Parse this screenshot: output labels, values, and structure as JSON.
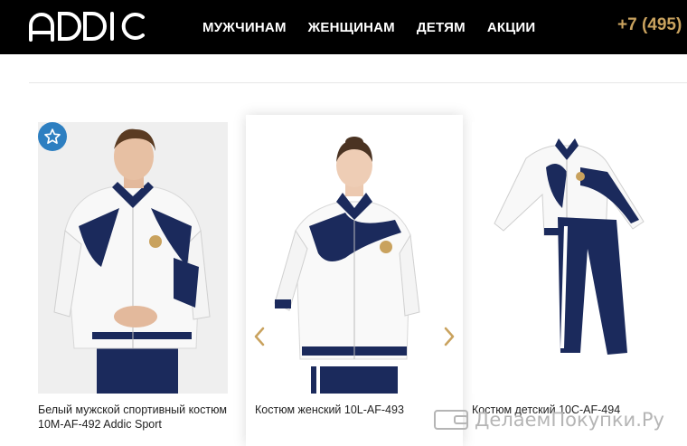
{
  "header": {
    "logo_text": "ADDIC",
    "nav": [
      "МУЖЧИНАМ",
      "ЖЕНЩИНАМ",
      "ДЕТЯМ",
      "АКЦИИ"
    ],
    "phone": "+7 (495)"
  },
  "products": [
    {
      "title": "Белый мужской спортивный костюм 10M-AF-492 Addic Sport",
      "image_icon": "man-tracksuit-photo",
      "favorite_icon": "star-icon"
    },
    {
      "title": "Костюм женский 10L-AF-493",
      "image_icon": "woman-tracksuit-photo"
    },
    {
      "title": "Костюм детский 10C-AF-494",
      "image_icon": "kids-tracksuit-photo"
    }
  ],
  "watermark": {
    "text": "ДелаемПокупки.Ру"
  },
  "colors": {
    "topbar": "#000000",
    "accent_gold": "#c9a25e",
    "fav_blue": "#2d7fc1",
    "navy": "#1b2a5c"
  }
}
